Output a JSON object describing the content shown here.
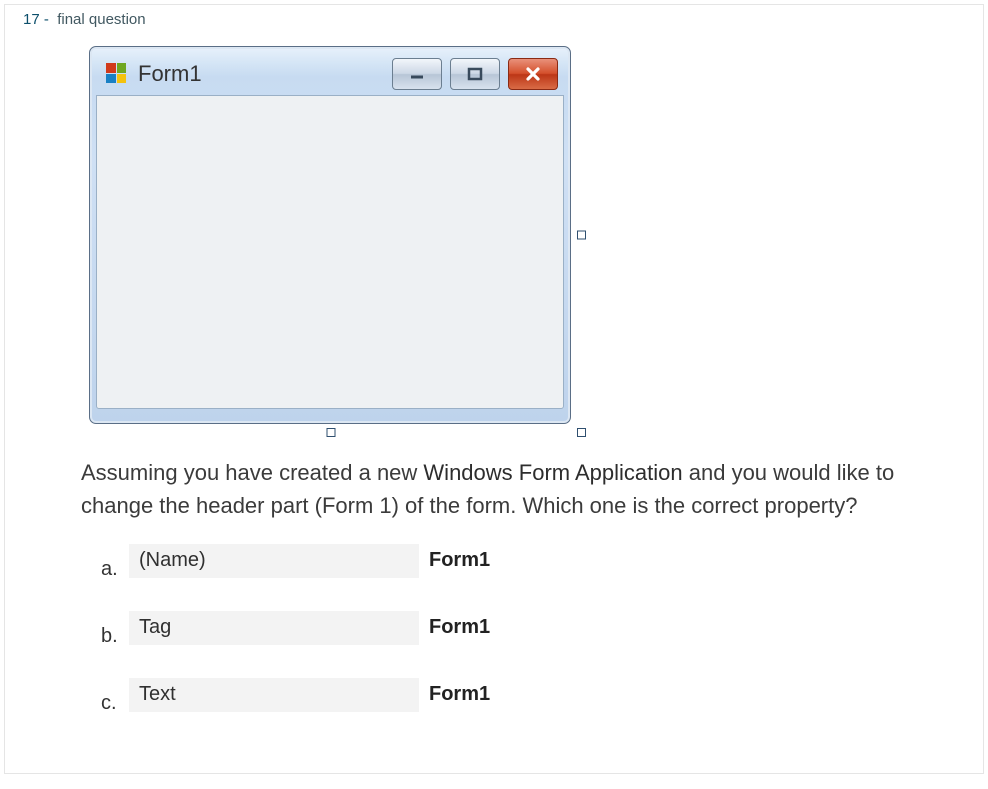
{
  "question": {
    "number": "17 -",
    "label": "final question",
    "prompt_before": "Assuming you have created a new ",
    "prompt_highlight": "Windows Form Application",
    "prompt_after": " and you would like to change the header part (Form 1) of the form. Which one is the correct property?"
  },
  "form_window": {
    "title": "Form1"
  },
  "options": [
    {
      "letter": "a.",
      "property": "(Name)",
      "value": "Form1"
    },
    {
      "letter": "b.",
      "property": "Tag",
      "value": "Form1"
    },
    {
      "letter": "c.",
      "property": "Text",
      "value": "Form1"
    }
  ]
}
